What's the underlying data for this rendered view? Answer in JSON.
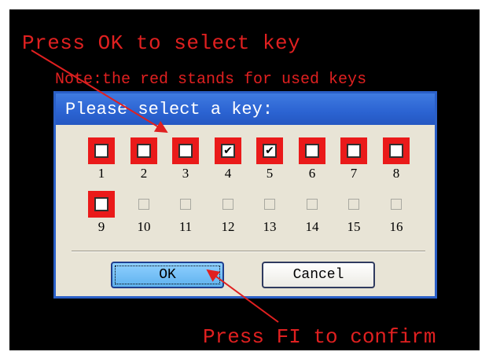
{
  "annotations": {
    "top": "Press OK to select key",
    "note": "Note:the red stands for used keys",
    "bottom": "Press  FI to confirm"
  },
  "dialog": {
    "title": "Please select a key:",
    "keys": [
      {
        "label": "1",
        "used": true,
        "checked": false,
        "enabled": true
      },
      {
        "label": "2",
        "used": true,
        "checked": false,
        "enabled": true
      },
      {
        "label": "3",
        "used": true,
        "checked": false,
        "enabled": true
      },
      {
        "label": "4",
        "used": true,
        "checked": true,
        "enabled": true
      },
      {
        "label": "5",
        "used": true,
        "checked": true,
        "enabled": true
      },
      {
        "label": "6",
        "used": true,
        "checked": false,
        "enabled": true
      },
      {
        "label": "7",
        "used": true,
        "checked": false,
        "enabled": true
      },
      {
        "label": "8",
        "used": true,
        "checked": false,
        "enabled": true
      },
      {
        "label": "9",
        "used": true,
        "checked": false,
        "enabled": true
      },
      {
        "label": "10",
        "used": false,
        "checked": false,
        "enabled": false
      },
      {
        "label": "11",
        "used": false,
        "checked": false,
        "enabled": false
      },
      {
        "label": "12",
        "used": false,
        "checked": false,
        "enabled": false
      },
      {
        "label": "13",
        "used": false,
        "checked": false,
        "enabled": false
      },
      {
        "label": "14",
        "used": false,
        "checked": false,
        "enabled": false
      },
      {
        "label": "15",
        "used": false,
        "checked": false,
        "enabled": false
      },
      {
        "label": "16",
        "used": false,
        "checked": false,
        "enabled": false
      }
    ],
    "ok_label": "OK",
    "cancel_label": "Cancel"
  },
  "colors": {
    "annotation_red": "#e02020",
    "used_key_red": "#ea1a1a",
    "titlebar_blue": "#2b63d2",
    "dialog_bg": "#e8e4d6"
  }
}
